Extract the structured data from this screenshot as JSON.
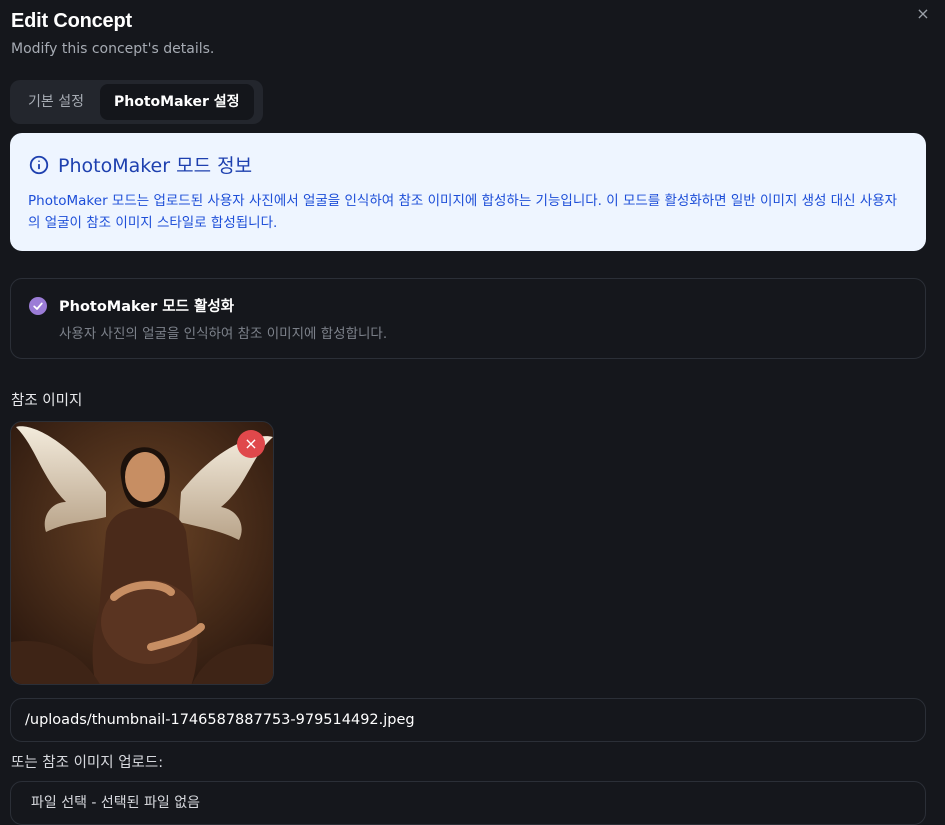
{
  "dialog": {
    "title": "Edit Concept",
    "subtitle": "Modify this concept's details.",
    "close_icon": "×"
  },
  "tabs": [
    {
      "label": "기본 설정",
      "active": false
    },
    {
      "label": "PhotoMaker 설정",
      "active": true
    }
  ],
  "info": {
    "icon": "info-circle-icon",
    "title": "PhotoMaker 모드 정보",
    "text": "PhotoMaker 모드는 업로드된 사용자 사진에서 얼굴을 인식하여 참조 이미지에 합성하는 기능입니다. 이 모드를 활성화하면 일반 이미지 생성 대신 사용자의 얼굴이 참조 이미지 스타일로 합성됩니다."
  },
  "photomaker_toggle": {
    "checked": true,
    "title": "PhotoMaker 모드 활성화",
    "description": "사용자 사진의 얼굴을 인식하여 참조 이미지에 합성합니다."
  },
  "reference": {
    "label": "참조 이미지",
    "path_value": "/uploads/thumbnail-1746587887753-979514492.jpeg",
    "remove_icon": "×",
    "upload_label": "또는 참조 이미지 업로드:",
    "file_status": "파일 선택 - 선택된 파일 없음"
  },
  "colors": {
    "background": "#15171c",
    "info_bg": "#eef5ff",
    "info_text": "#1d4ed8",
    "check_accent": "#9b7cd6",
    "remove_button": "#e0484b"
  }
}
